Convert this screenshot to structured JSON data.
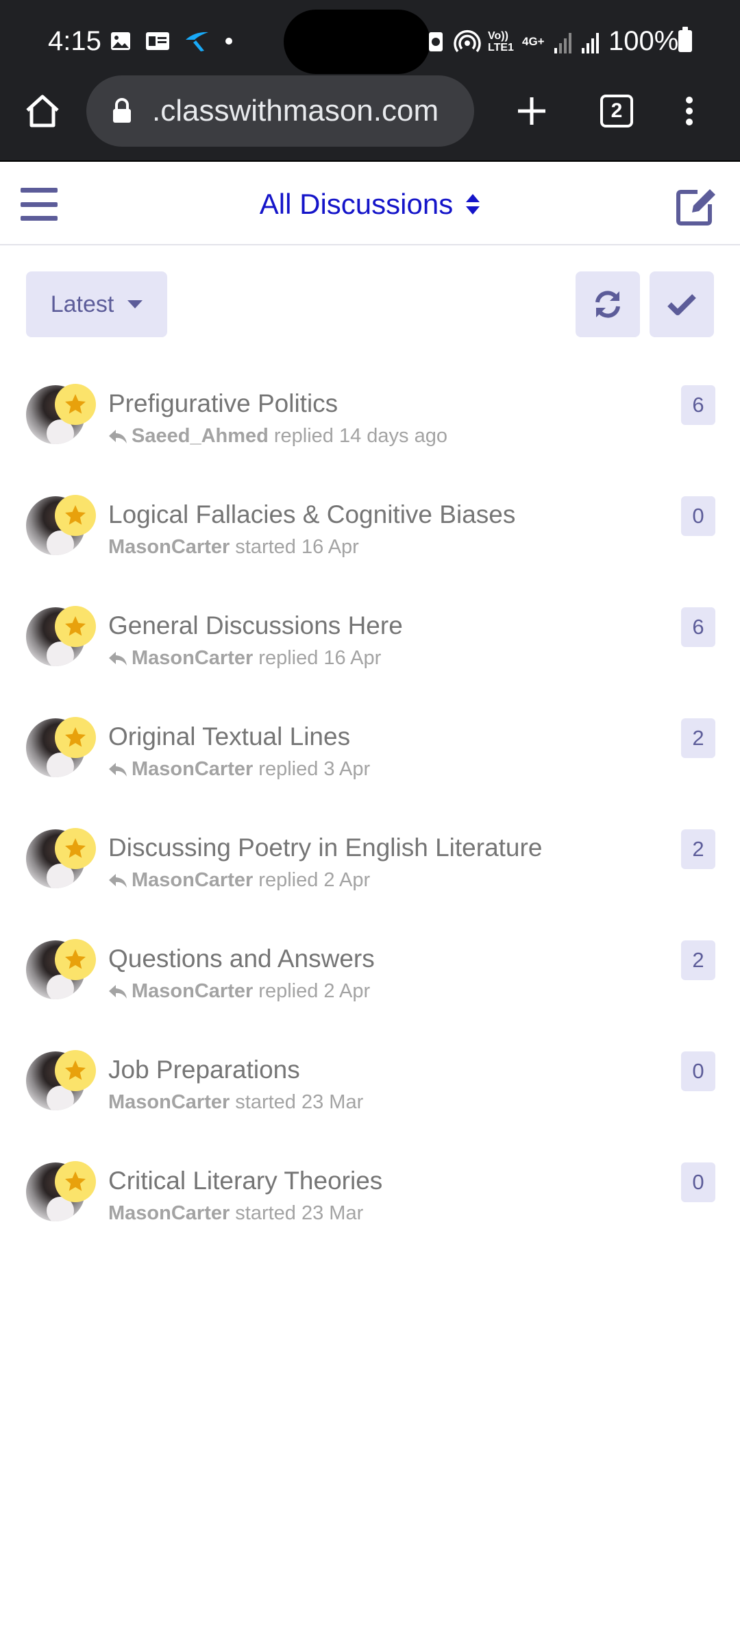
{
  "status_bar": {
    "time": "4:15",
    "battery": "100%",
    "network_label": "4G+",
    "volte_label": "Vo)) LTE1"
  },
  "browser": {
    "url": ".classwithmason.com",
    "tab_count": "2"
  },
  "header": {
    "title": "All Discussions"
  },
  "toolbar": {
    "sort_label": "Latest"
  },
  "colors": {
    "accent": "#1515c9",
    "muted_purple": "#5c5c99",
    "button_bg": "#e5e5f6",
    "badge_yellow": "#fbe36b",
    "star_orange": "#e8a10c"
  },
  "discussions": [
    {
      "title": "Prefigurative Politics",
      "user": "Saeed_Ahmed",
      "action": "replied 14 days ago",
      "replied": true,
      "count": "6"
    },
    {
      "title": "Logical Fallacies & Cognitive Biases",
      "user": "MasonCarter",
      "action": "started 16 Apr",
      "replied": false,
      "count": "0"
    },
    {
      "title": "General Discussions Here",
      "user": "MasonCarter",
      "action": "replied 16 Apr",
      "replied": true,
      "count": "6"
    },
    {
      "title": "Original Textual Lines",
      "user": "MasonCarter",
      "action": "replied 3 Apr",
      "replied": true,
      "count": "2"
    },
    {
      "title": "Discussing Poetry in English Literature",
      "user": "MasonCarter",
      "action": "replied 2 Apr",
      "replied": true,
      "count": "2"
    },
    {
      "title": "Questions and Answers",
      "user": "MasonCarter",
      "action": "replied 2 Apr",
      "replied": true,
      "count": "2"
    },
    {
      "title": "Job Preparations",
      "user": "MasonCarter",
      "action": "started 23 Mar",
      "replied": false,
      "count": "0"
    },
    {
      "title": "Critical Literary Theories",
      "user": "MasonCarter",
      "action": "started 23 Mar",
      "replied": false,
      "count": "0"
    }
  ]
}
